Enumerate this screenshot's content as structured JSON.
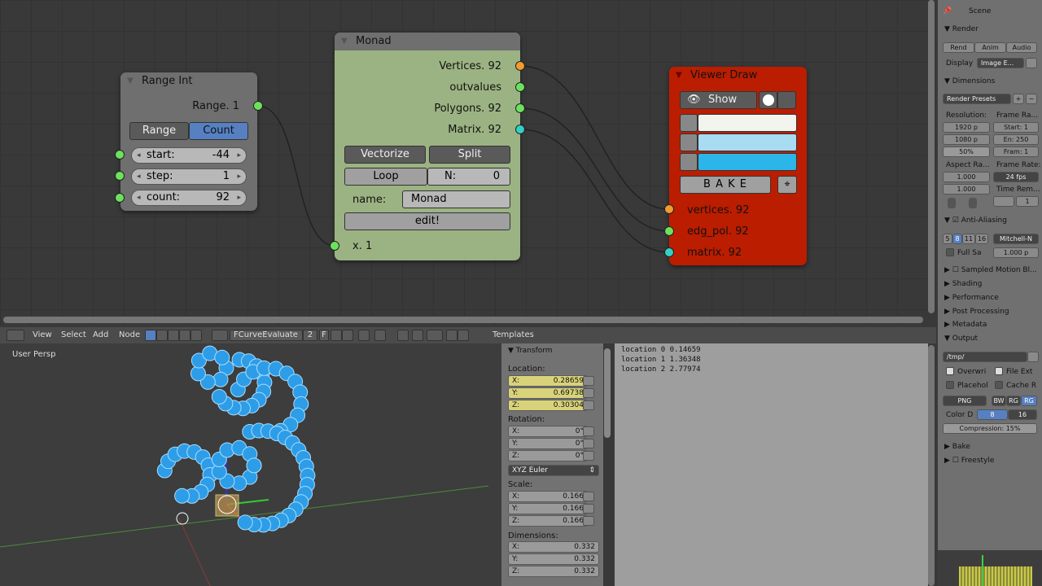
{
  "node_editor": {
    "range_int": {
      "title": "Range Int",
      "output": "Range. 1",
      "mode_range": "Range",
      "mode_count": "Count",
      "start_label": "start:",
      "start_value": "-44",
      "step_label": "step:",
      "step_value": "1",
      "count_label": "count:",
      "count_value": "92"
    },
    "monad": {
      "title": "Monad",
      "out_vertices": "Vertices. 92",
      "out_outvalues": "outvalues",
      "out_polygons": "Polygons. 92",
      "out_matrix": "Matrix. 92",
      "vectorize": "Vectorize",
      "split": "Split",
      "loop": "Loop",
      "n_label": "N:",
      "n_value": "0",
      "name_label": "name:",
      "name_value": "Monad",
      "edit": "edit!",
      "input_x": "x. 1"
    },
    "viewer_draw": {
      "title": "Viewer Draw",
      "show": "Show",
      "bake": "B A K E",
      "in_vertices": "vertices. 92",
      "in_edg_pol": "edg_pol. 92",
      "in_matrix": "matrix. 92"
    }
  },
  "header": {
    "view": "View",
    "select": "Select",
    "add": "Add",
    "node": "Node",
    "tree_name": "FCurveEvaluate",
    "users": "2",
    "f": "F",
    "templates": "Templates"
  },
  "viewport": {
    "label": "User Persp"
  },
  "transform": {
    "title": "Transform",
    "location": "Location:",
    "loc": [
      {
        "a": "X:",
        "v": "0.28659"
      },
      {
        "a": "Y:",
        "v": "0.69738"
      },
      {
        "a": "Z:",
        "v": "0.30304"
      }
    ],
    "rotation": "Rotation:",
    "rot": [
      {
        "a": "X:",
        "v": "0°"
      },
      {
        "a": "Y:",
        "v": "0°"
      },
      {
        "a": "Z:",
        "v": "0°"
      }
    ],
    "rot_mode": "XYZ Euler",
    "scale": "Scale:",
    "scl": [
      {
        "a": "X:",
        "v": "0.166"
      },
      {
        "a": "Y:",
        "v": "0.166"
      },
      {
        "a": "Z:",
        "v": "0.166"
      }
    ],
    "dimensions": "Dimensions:",
    "dim": [
      {
        "a": "X:",
        "v": "0.332"
      },
      {
        "a": "Y:",
        "v": "0.332"
      },
      {
        "a": "Z:",
        "v": "0.332"
      }
    ]
  },
  "text_editor": {
    "lines": [
      "location 0 0.14659",
      "location 1 1.36348",
      "location 2 2.77974"
    ]
  },
  "properties": {
    "scene": "Scene",
    "render": "Render",
    "rend": "Rend",
    "anim": "Anim",
    "audio": "Audio",
    "display": "Display",
    "display_value": "Image E...",
    "dimensions": "Dimensions",
    "presets": "Render Presets",
    "resolution": "Resolution:",
    "frame_range": "Frame Ra...",
    "res_x": "1920 p",
    "res_y": "1080 p",
    "res_pct": "50%",
    "start": "Start: 1",
    "end": "En: 250",
    "frame": "Fram: 1",
    "aspect": "Aspect Ra...",
    "frame_rate": "Frame Rate:",
    "asp_x": "1.000",
    "asp_y": "1.000",
    "fps": "24 fps",
    "time_rem": "Time Rem...",
    "time_val": "1",
    "anti_aliasing": "Anti-Aliasing",
    "aa": [
      "5",
      "8",
      "11",
      "16"
    ],
    "filter": "Mitchell-N",
    "full_sa": "Full Sa",
    "full_sa_val": "1.000 p",
    "motion_blur": "Sampled Motion Bl...",
    "shading": "Shading",
    "performance": "Performance",
    "post_processing": "Post Processing",
    "metadata": "Metadata",
    "output": "Output",
    "path": "/tmp/",
    "overwrite": "Overwri",
    "file_ext": "File Ext",
    "placeholder": "Placehol",
    "cache": "Cache R",
    "format": "PNG",
    "bw": "BW",
    "rgb": "RG",
    "rgba": "RG",
    "color_depth": "Color D",
    "cd8": "8",
    "cd16": "16",
    "compression": "Compression:",
    "compression_val": "15%",
    "bake": "Bake",
    "freestyle": "Freestyle"
  }
}
